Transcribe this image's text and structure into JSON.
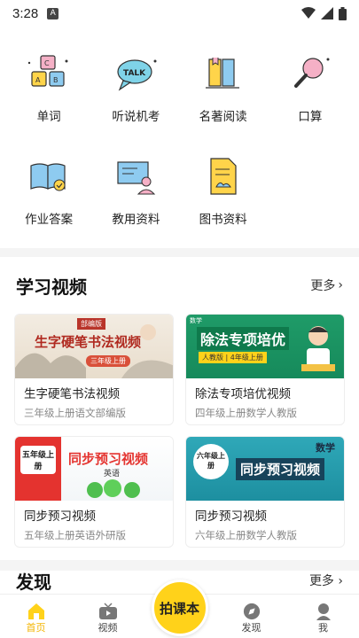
{
  "status": {
    "time": "3:28",
    "badge": "A"
  },
  "tools": [
    {
      "label": "单词",
      "icon": "word-blocks-icon"
    },
    {
      "label": "听说机考",
      "icon": "talk-bubble-icon"
    },
    {
      "label": "名著阅读",
      "icon": "books-icon"
    },
    {
      "label": "口算",
      "icon": "magnifier-icon"
    },
    {
      "label": "作业答案",
      "icon": "open-book-check-icon"
    },
    {
      "label": "教用资料",
      "icon": "teacher-board-icon"
    },
    {
      "label": "图书资料",
      "icon": "document-icon"
    }
  ],
  "videos": {
    "title": "学习视频",
    "more": "更多",
    "items": [
      {
        "title": "生字硬笔书法视频",
        "sub": "三年级上册语文部编版",
        "thumb_text": "生字硬笔书法视频",
        "tag_top": "部编版",
        "tag_bottom": "三年级上册"
      },
      {
        "title": "除法专项培优视频",
        "sub": "四年级上册数学人教版",
        "thumb_text": "除法专项培优",
        "tag_top": "数学",
        "tag_bottom": "人教版 | 4年级上册"
      },
      {
        "title": "同步预习视频",
        "sub": "五年级上册英语外研版",
        "thumb_text": "同步预习视频",
        "tag_top": "五年级上册",
        "tag_bottom": "英语"
      },
      {
        "title": "同步预习视频",
        "sub": "六年级上册数学人教版",
        "thumb_text": "同步预习视频",
        "tag_top": "六年级上册",
        "tag_bottom": "数学"
      }
    ]
  },
  "discover": {
    "title": "发现",
    "more": "更多"
  },
  "nav": {
    "home": "首页",
    "video": "视频",
    "center": "拍课本",
    "discover": "发现",
    "me": "我"
  },
  "colors": {
    "accent": "#f3b400",
    "fab": "#ffd21a"
  }
}
